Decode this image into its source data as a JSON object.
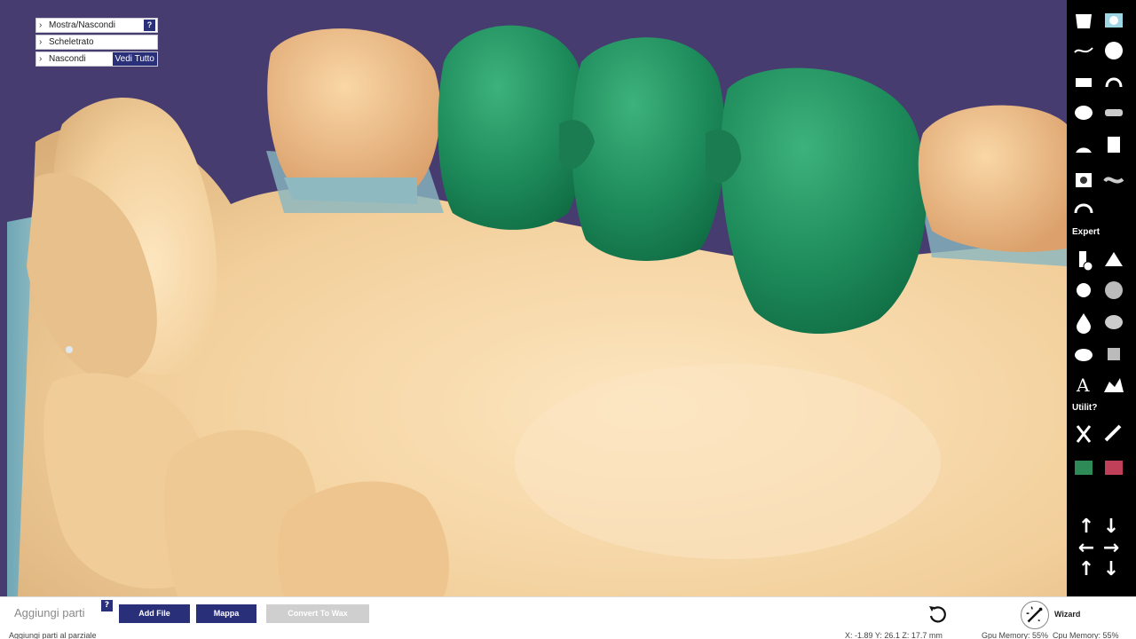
{
  "tree": {
    "items": [
      {
        "label": "Mostra/Nascondi",
        "help": "?"
      },
      {
        "label": "Scheletrato"
      },
      {
        "label": "Nascondi",
        "action": "Vedi Tutto"
      }
    ]
  },
  "toolbar": {
    "sections": {
      "expert": "Expert",
      "utilities": "Utilit?"
    }
  },
  "bottombar": {
    "title": "Aggiungi parti",
    "help": "?",
    "buttons": {
      "add_file": "Add File",
      "mappa": "Mappa",
      "convert_to_wax": "Convert To Wax"
    },
    "wizard": "Wizard"
  },
  "statusbar": {
    "hint": "Aggiungi parti al parziale",
    "coords": "X: -1.89   Y: 26.1   Z: 17.7   mm",
    "gpu": "Gpu Memory: 55%",
    "cpu": "Cpu Memory: 55%"
  },
  "colors": {
    "background": "#473c6f",
    "model": "#f3cf9c",
    "wax_crowns": "#1e8a5a",
    "accent": "#2a2f7a"
  }
}
